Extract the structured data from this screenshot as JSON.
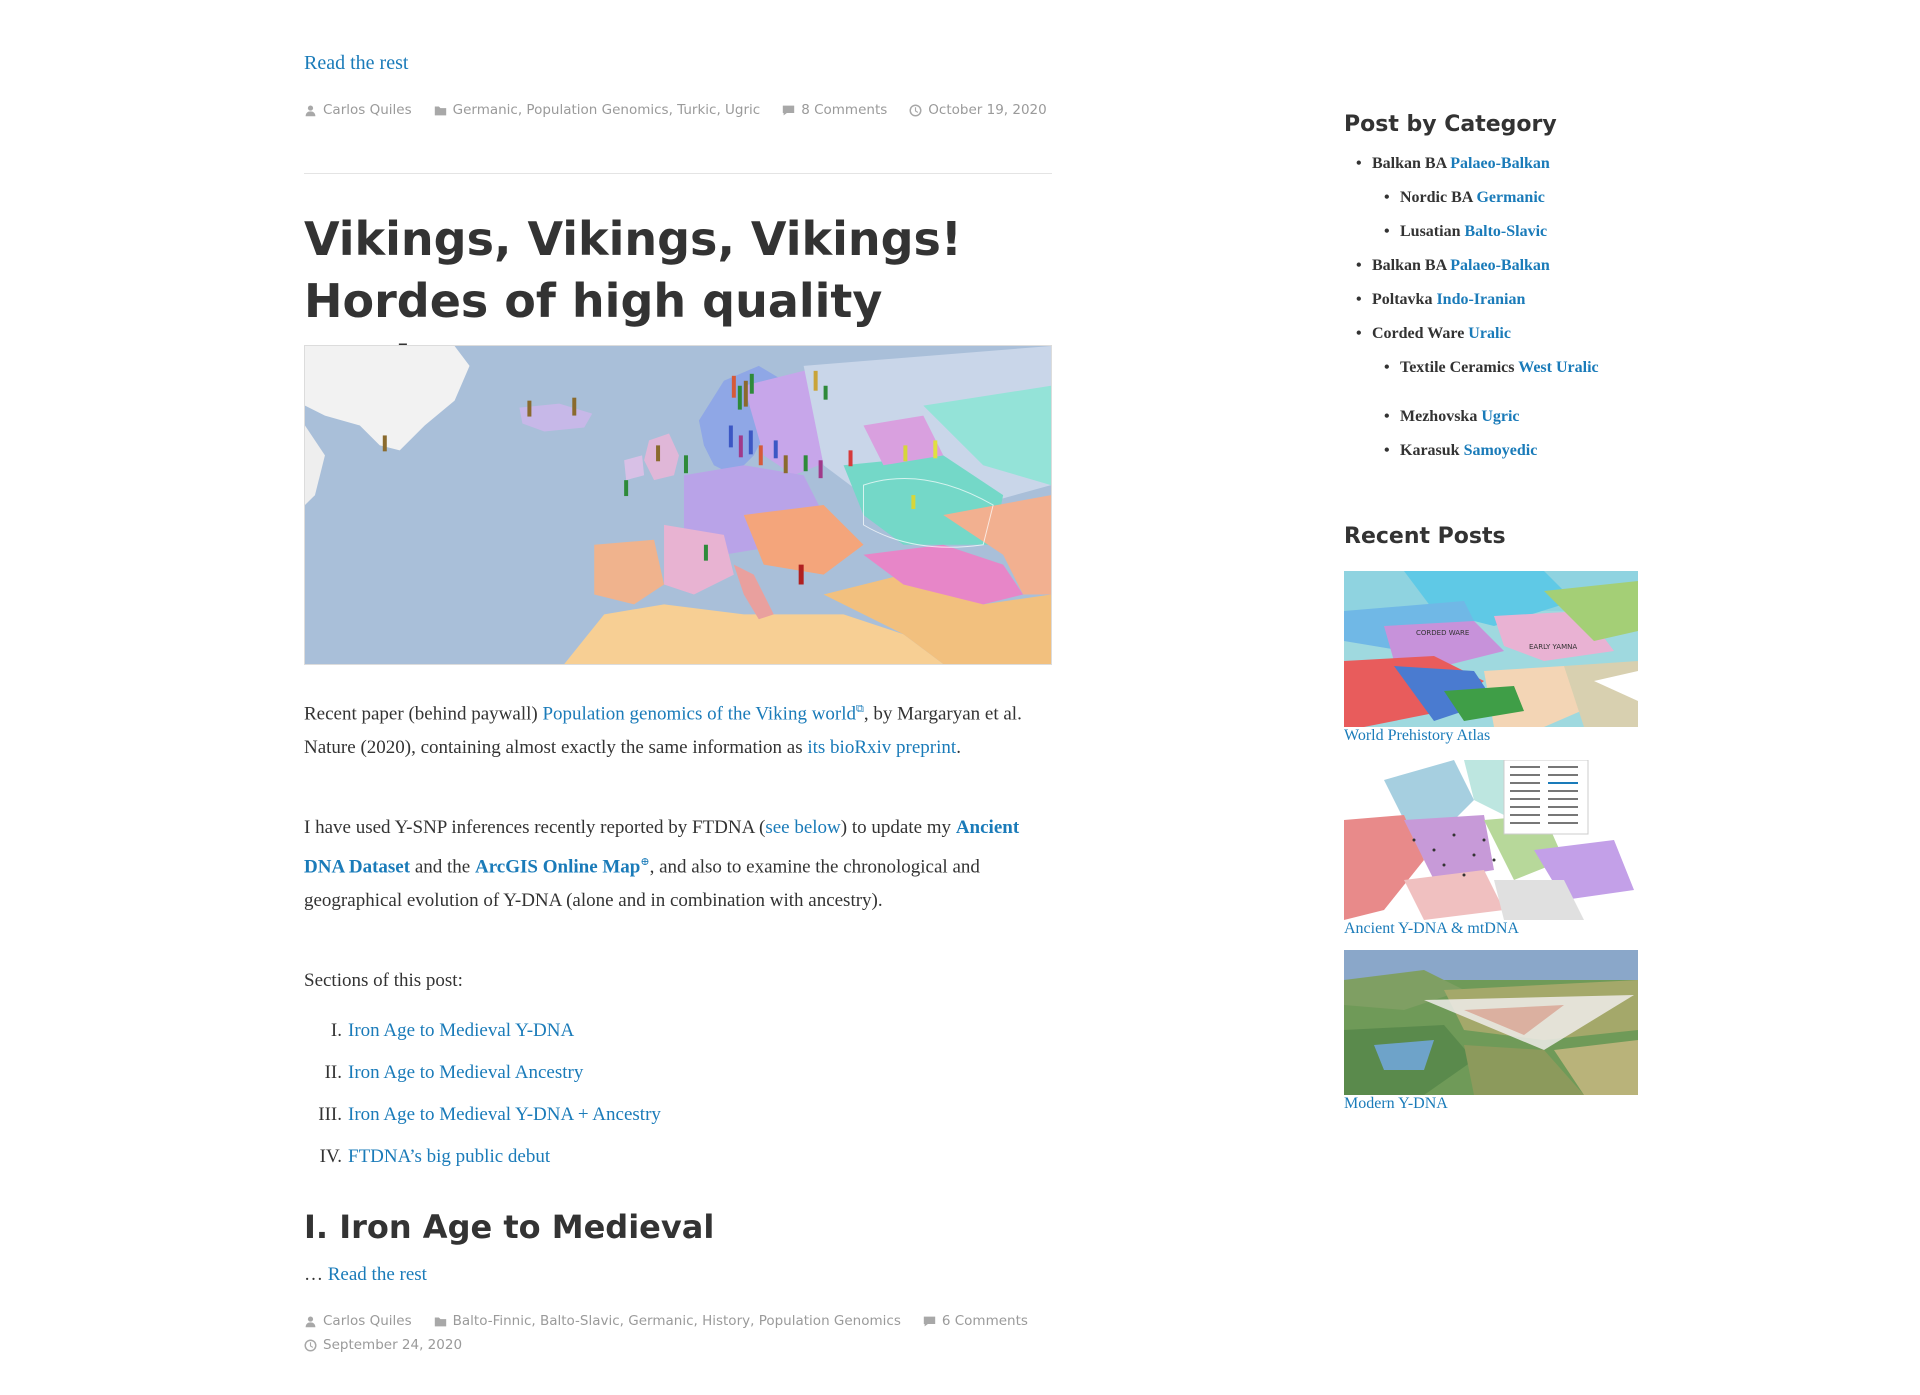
{
  "prev_post": {
    "read_more": "Read the rest",
    "author": "Carlos Quiles",
    "categories": "Germanic, Population Genomics, Turkic, Ugric",
    "comments": "8 Comments",
    "date": "October 19, 2020"
  },
  "post": {
    "title": "Vikings, Vikings, Vikings! Hordes of high quality ancient DNA",
    "p1": {
      "t1": "Recent paper (behind paywall) ",
      "l1": "Population genomics of the Viking world",
      "t2": ", by Margaryan et al. Nature (2020), containing almost exactly the same information as ",
      "l2": "its bioRxiv preprint",
      "t3": "."
    },
    "p2": {
      "t1": "I have used Y-SNP inferences recently reported by FTDNA (",
      "l1": "see below",
      "t2": ") to update my ",
      "l2": "Ancient DNA Dataset",
      "t3": " and the ",
      "l3": "ArcGIS Online Map",
      "t4": ", and also to examine the chronological and geographical evolution of Y-DNA (alone and in combination with ancestry)."
    },
    "p3": "Sections of this post:",
    "toc": [
      {
        "num": "I.",
        "label": "Iron Age to Medieval Y-DNA"
      },
      {
        "num": "II.",
        "label": "Iron Age to Medieval Ancestry"
      },
      {
        "num": "III.",
        "label": "Iron Age to Medieval Y-DNA + Ancestry"
      },
      {
        "num": "IV.",
        "label": "FTDNA’s big public debut"
      }
    ],
    "h2": "I. Iron Age to Medieval",
    "ellipsis": "… ",
    "read_more": "Read the rest",
    "author": "Carlos Quiles",
    "categories": "Balto-Finnic, Balto-Slavic, Germanic, History, Population Genomics",
    "comments": "6 Comments",
    "date": "September 24, 2020"
  },
  "sidebar": {
    "category_title": "Post by Category",
    "categories": [
      {
        "label": "Balkan BA",
        "link": "Palaeo-Balkan"
      },
      {
        "label": "Nordic BA",
        "link": "Germanic"
      },
      {
        "label": "Lusatian",
        "link": "Balto-Slavic"
      },
      {
        "label": "Balkan BA",
        "link": "Palaeo-Balkan"
      },
      {
        "label": "Poltavka",
        "link": "Indo-Iranian"
      },
      {
        "label": "Corded Ware",
        "link": "Uralic"
      },
      {
        "label": "Textile Ceramics",
        "link": "West Uralic"
      },
      {
        "label": "Mezhovska",
        "link": "Ugric"
      },
      {
        "label": "Karasuk",
        "link": "Samoyedic"
      }
    ],
    "recent_title": "Recent Posts",
    "recent": [
      {
        "caption": "World Prehistory Atlas",
        "map_labels": [
          "CORDED WARE",
          "EARLY YAMNA"
        ]
      },
      {
        "caption": "Ancient Y-DNA & mtDNA"
      },
      {
        "caption": "Modern Y-DNA"
      }
    ]
  },
  "icons": {
    "author": "person-icon",
    "category": "folder-icon",
    "comments": "comment-bubble-icon",
    "date": "clock-icon",
    "external": "external-link-icon",
    "globe": "globe-icon"
  },
  "colors": {
    "link": "#1a7bb9",
    "text": "#333333",
    "meta": "#9a9a9a"
  }
}
